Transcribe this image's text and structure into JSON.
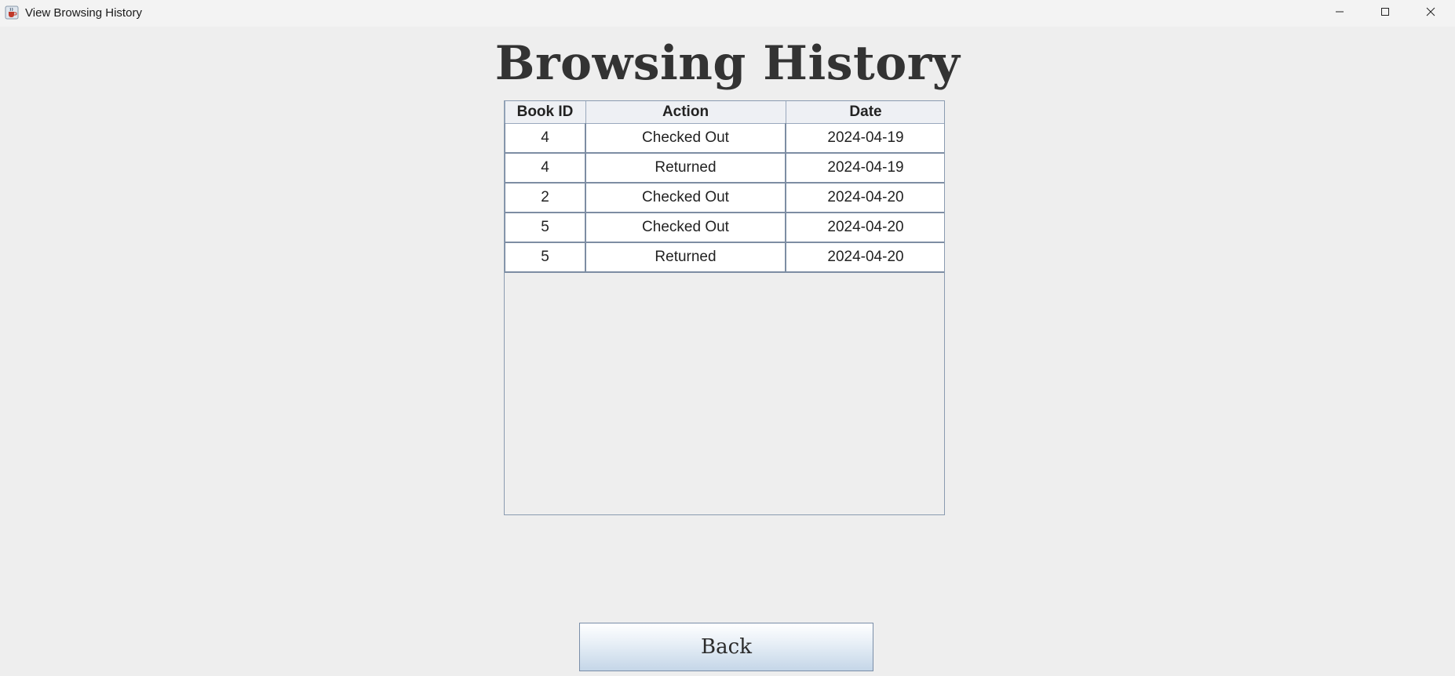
{
  "window": {
    "title": "View Browsing History",
    "icon": "java-cup-icon"
  },
  "page": {
    "heading": "Browsing History"
  },
  "table": {
    "columns": [
      "Book ID",
      "Action",
      "Date"
    ],
    "rows": [
      [
        "4",
        "Checked Out",
        "2024-04-19"
      ],
      [
        "4",
        "Returned",
        "2024-04-19"
      ],
      [
        "2",
        "Checked Out",
        "2024-04-20"
      ],
      [
        "5",
        "Checked Out",
        "2024-04-20"
      ],
      [
        "5",
        "Returned",
        "2024-04-20"
      ]
    ]
  },
  "actions": {
    "back_label": "Back"
  },
  "colors": {
    "background": "#eeeeee",
    "heading": "#333333",
    "table_border": "#7d8da3",
    "button_gradient_bottom": "#c5d6e8"
  }
}
